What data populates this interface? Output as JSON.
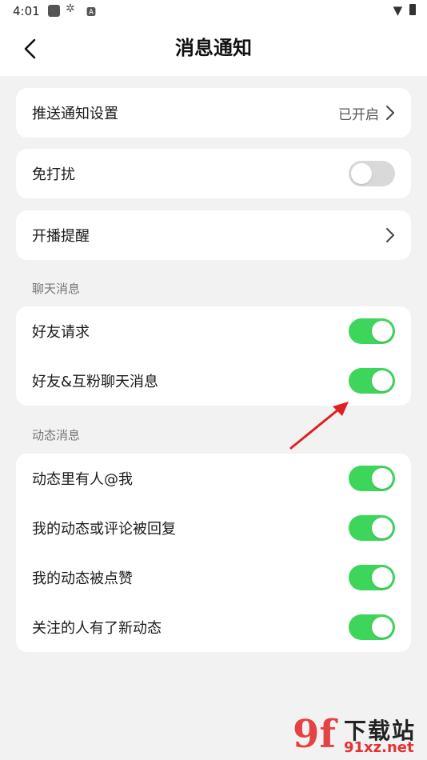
{
  "status_bar": {
    "time": "4:01",
    "icons": [
      "gallery-icon",
      "settings-icon",
      "font-icon"
    ],
    "right_icons": [
      "wifi-icon",
      "battery-icon"
    ]
  },
  "header": {
    "title": "消息通知",
    "back_icon": "back-arrow-icon"
  },
  "cards": {
    "push": {
      "label": "推送通知设置",
      "value": "已开启"
    },
    "dnd": {
      "label": "免打扰",
      "enabled": false
    },
    "live": {
      "label": "开播提醒"
    }
  },
  "chat_section": {
    "title": "聊天消息",
    "items": [
      {
        "label": "好友请求",
        "enabled": true
      },
      {
        "label": "好友&互粉聊天消息",
        "enabled": true
      }
    ]
  },
  "feed_section": {
    "title": "动态消息",
    "items": [
      {
        "label": "动态里有人@我",
        "enabled": true
      },
      {
        "label": "我的动态或评论被回复",
        "enabled": true
      },
      {
        "label": "我的动态被点赞",
        "enabled": true
      },
      {
        "label": "关注的人有了新动态",
        "enabled": true
      }
    ]
  },
  "colors": {
    "toggle_on": "#3dd65b",
    "toggle_off": "#d9d9d9",
    "annotation_arrow": "#e02020"
  },
  "watermark": {
    "logo": "9f",
    "brand": "下载站",
    "url": "91xz.net"
  }
}
